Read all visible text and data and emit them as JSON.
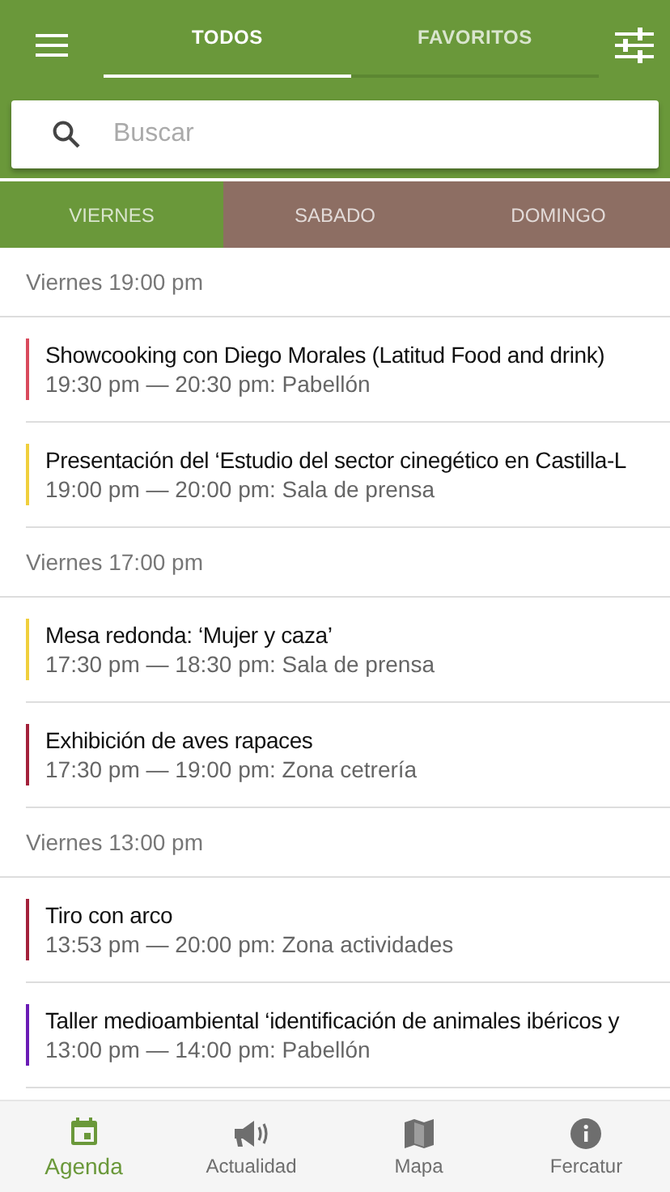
{
  "top_tabs": [
    {
      "label": "TODOS",
      "selected": true
    },
    {
      "label": "FAVORITOS",
      "selected": false
    }
  ],
  "search": {
    "placeholder": "Buscar"
  },
  "day_tabs": [
    {
      "label": "VIERNES",
      "selected": true
    },
    {
      "label": "SABADO",
      "selected": false
    },
    {
      "label": "DOMINGO",
      "selected": false
    }
  ],
  "sections": [
    {
      "heading": "Viernes 19:00 pm",
      "events": [
        {
          "title": "Showcooking con Diego Morales (Latitud Food and drink)",
          "time": "19:30 pm — 20:30 pm: Pabellón",
          "color": "#d94a5c"
        },
        {
          "title": "Presentación del ‘Estudio del sector cinegético en Castilla-L",
          "time": "19:00 pm — 20:00 pm: Sala de prensa",
          "color": "#f0cf3c"
        }
      ]
    },
    {
      "heading": "Viernes 17:00 pm",
      "events": [
        {
          "title": "Mesa redonda: ‘Mujer y caza’",
          "time": "17:30 pm — 18:30 pm: Sala de prensa",
          "color": "#f0cf3c"
        },
        {
          "title": "Exhibición de aves rapaces",
          "time": "17:30 pm — 19:00 pm: Zona cetrería",
          "color": "#a3213a"
        }
      ]
    },
    {
      "heading": "Viernes 13:00 pm",
      "events": [
        {
          "title": "Tiro con arco",
          "time": "13:53 pm — 20:00 pm: Zona actividades",
          "color": "#a3213a"
        },
        {
          "title": "Taller medioambiental ‘identificación de animales ibéricos y",
          "time": "13:00 pm — 14:00 pm: Pabellón",
          "color": "#6a1bb5"
        }
      ]
    }
  ],
  "bottom_nav": [
    {
      "label": "Agenda",
      "kind": "calendar",
      "selected": true
    },
    {
      "label": "Actualidad",
      "kind": "megaphone",
      "selected": false
    },
    {
      "label": "Mapa",
      "kind": "map",
      "selected": false
    },
    {
      "label": "Fercatur",
      "kind": "info",
      "selected": false
    }
  ]
}
